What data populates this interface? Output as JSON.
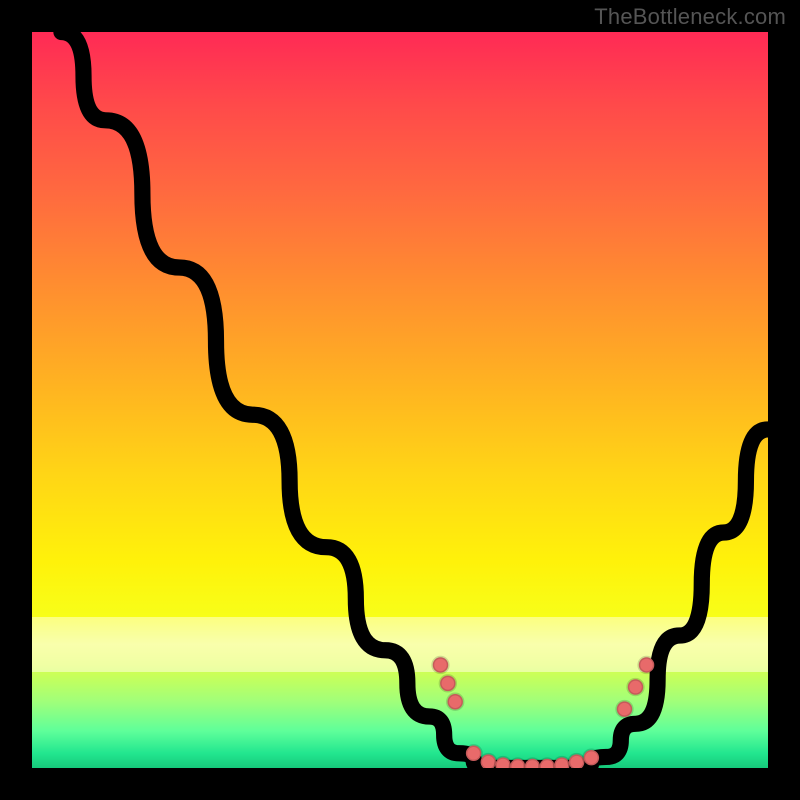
{
  "watermark": "TheBottleneck.com",
  "chart_data": {
    "type": "line",
    "title": "",
    "xlabel": "",
    "ylabel": "",
    "x_range": [
      0,
      100
    ],
    "y_range": [
      0,
      100
    ],
    "series": [
      {
        "name": "bottleneck-curve",
        "points": [
          {
            "x": 4,
            "y": 100
          },
          {
            "x": 10,
            "y": 88
          },
          {
            "x": 20,
            "y": 68
          },
          {
            "x": 30,
            "y": 48
          },
          {
            "x": 40,
            "y": 30
          },
          {
            "x": 48,
            "y": 16
          },
          {
            "x": 54,
            "y": 7
          },
          {
            "x": 58,
            "y": 2
          },
          {
            "x": 62,
            "y": 0
          },
          {
            "x": 68,
            "y": 0
          },
          {
            "x": 74,
            "y": 0
          },
          {
            "x": 78,
            "y": 1.5
          },
          {
            "x": 82,
            "y": 6
          },
          {
            "x": 88,
            "y": 18
          },
          {
            "x": 94,
            "y": 32
          },
          {
            "x": 100,
            "y": 46
          }
        ]
      }
    ],
    "markers": [
      {
        "x": 55.5,
        "y": 14
      },
      {
        "x": 56.5,
        "y": 11.5
      },
      {
        "x": 57.5,
        "y": 9
      },
      {
        "x": 60,
        "y": 2
      },
      {
        "x": 62,
        "y": 0.8
      },
      {
        "x": 64,
        "y": 0.4
      },
      {
        "x": 66,
        "y": 0.2
      },
      {
        "x": 68,
        "y": 0.2
      },
      {
        "x": 70,
        "y": 0.2
      },
      {
        "x": 72,
        "y": 0.4
      },
      {
        "x": 74,
        "y": 0.8
      },
      {
        "x": 76,
        "y": 1.4
      },
      {
        "x": 80.5,
        "y": 8
      },
      {
        "x": 82,
        "y": 11
      },
      {
        "x": 83.5,
        "y": 14
      }
    ],
    "gradient_stops": [
      {
        "pos": 0,
        "color": "#ff2a55"
      },
      {
        "pos": 50,
        "color": "#ffd516"
      },
      {
        "pos": 80,
        "color": "#f7ff1a"
      },
      {
        "pos": 100,
        "color": "#16c97b"
      }
    ]
  }
}
